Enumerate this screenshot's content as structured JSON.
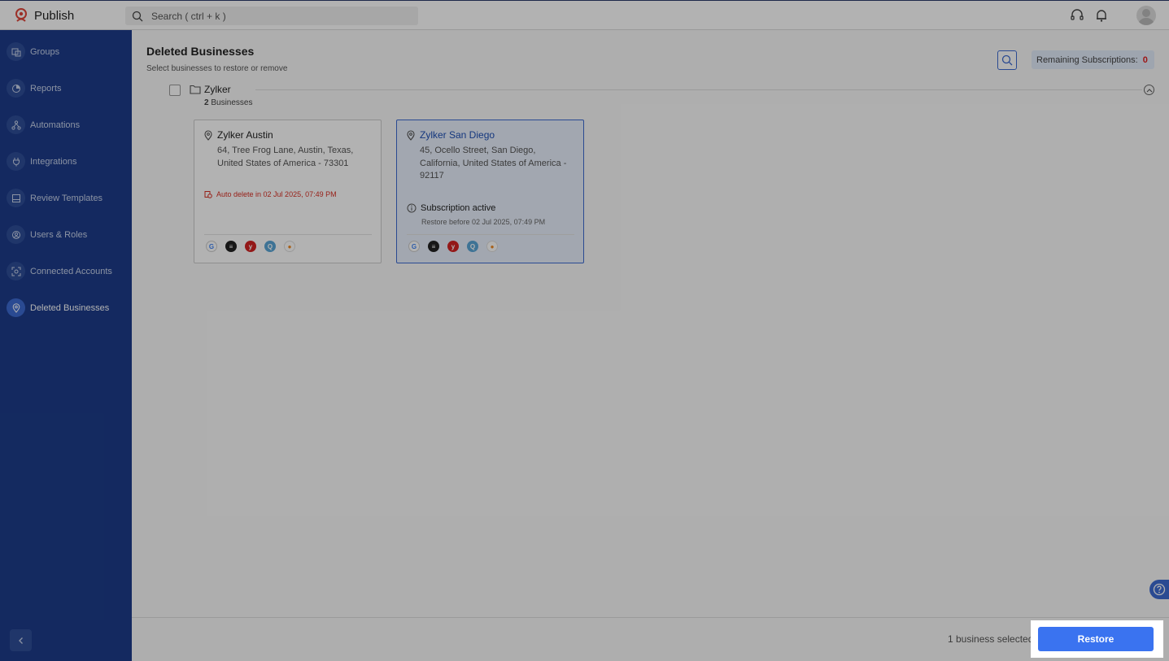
{
  "app": {
    "name": "Publish"
  },
  "search": {
    "placeholder": "Search ( ctrl + k )"
  },
  "sidebar": {
    "items": [
      {
        "label": "Groups"
      },
      {
        "label": "Reports"
      },
      {
        "label": "Automations"
      },
      {
        "label": "Integrations"
      },
      {
        "label": "Review Templates"
      },
      {
        "label": "Users & Roles"
      },
      {
        "label": "Connected Accounts"
      },
      {
        "label": "Deleted Businesses",
        "active": true
      }
    ]
  },
  "page": {
    "title": "Deleted Businesses",
    "subtitle": "Select businesses to restore or remove",
    "remaining_label": "Remaining Subscriptions:",
    "remaining_count": "0"
  },
  "group": {
    "name": "Zylker",
    "count": "2",
    "count_suffix": " Businesses"
  },
  "cards": [
    {
      "name": "Zylker Austin",
      "address": "64, Tree Frog Lane, Austin, Texas, United States of America - 73301",
      "auto_delete": "Auto delete in 02 Jul 2025, 07:49 PM",
      "selected": false
    },
    {
      "name": "Zylker San Diego",
      "address": "45, Ocello Street, San Diego, California, United States of America - 92117",
      "status": "Subscription active",
      "restore_before": "Restore before 02 Jul 2025, 07:49 PM",
      "selected": true
    }
  ],
  "channels": [
    "google-icon",
    "apple-business-icon",
    "yelp-icon",
    "quora-icon",
    "maps-pin-icon"
  ],
  "footer": {
    "selected_text": "1 business selected",
    "restore_label": "Restore"
  },
  "colors": {
    "sidebar": "#1d3c8a",
    "accent": "#3a73f0",
    "danger": "#d93025"
  }
}
